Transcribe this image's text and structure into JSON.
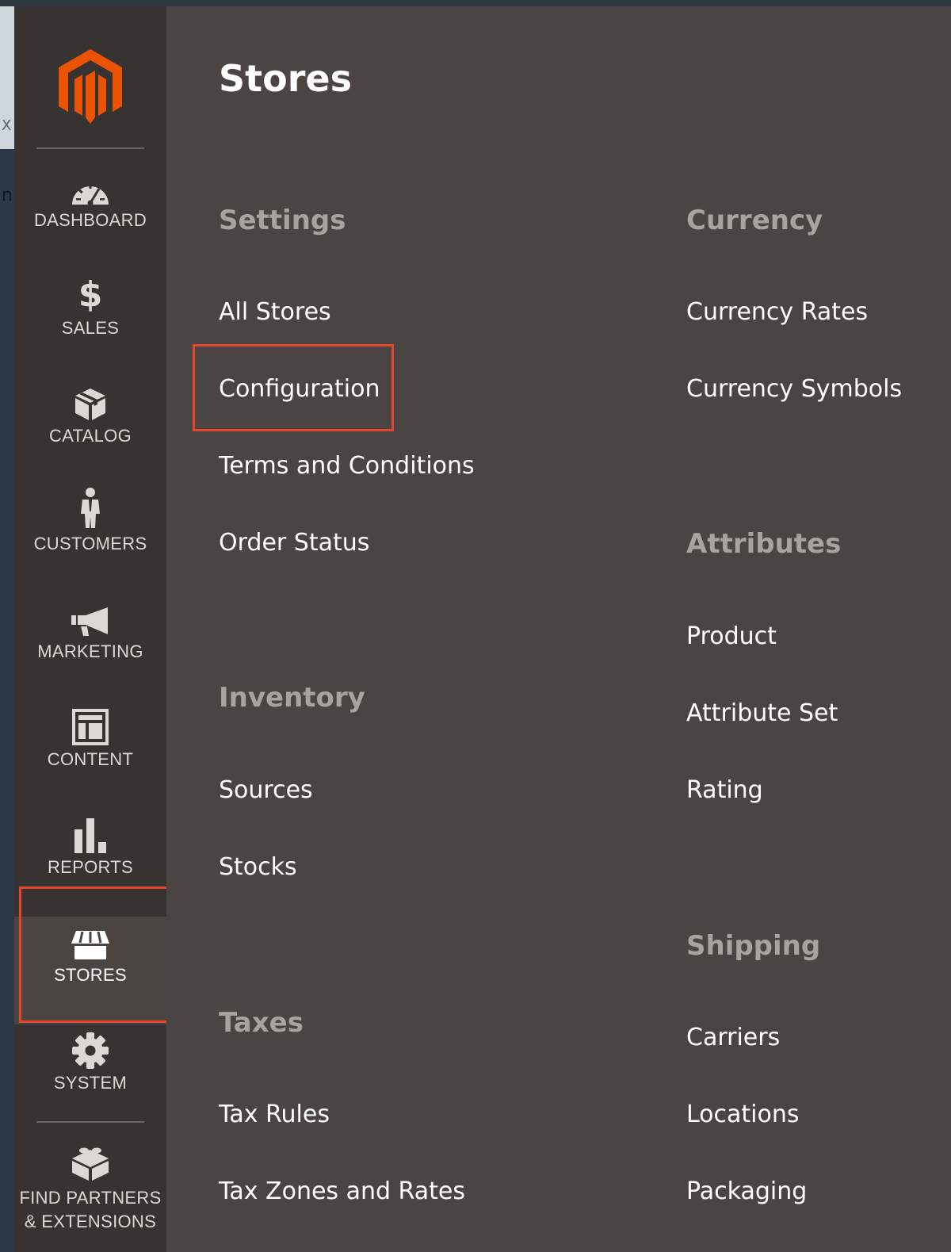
{
  "edge": {
    "fragments": [
      "n",
      "X"
    ]
  },
  "sidebar": {
    "items": [
      {
        "label": "DASHBOARD",
        "icon": "dashboard-gauge-icon"
      },
      {
        "label": "SALES",
        "icon": "dollar-icon"
      },
      {
        "label": "CATALOG",
        "icon": "box-icon"
      },
      {
        "label": "CUSTOMERS",
        "icon": "person-icon"
      },
      {
        "label": "MARKETING",
        "icon": "megaphone-icon"
      },
      {
        "label": "CONTENT",
        "icon": "layout-icon"
      },
      {
        "label": "REPORTS",
        "icon": "bar-chart-icon"
      },
      {
        "label": "STORES",
        "icon": "storefront-icon",
        "active": true
      },
      {
        "label": "SYSTEM",
        "icon": "gear-icon"
      }
    ],
    "extensions": {
      "line1": "FIND PARTNERS",
      "line2": "& EXTENSIONS",
      "icon": "bricks-icon"
    }
  },
  "panel": {
    "title": "Stores",
    "settings": {
      "title": "Settings",
      "links": [
        "All Stores",
        "Configuration",
        "Terms and Conditions",
        "Order Status"
      ]
    },
    "inventory": {
      "title": "Inventory",
      "links": [
        "Sources",
        "Stocks"
      ]
    },
    "taxes": {
      "title": "Taxes",
      "links": [
        "Tax Rules",
        "Tax Zones and Rates"
      ]
    },
    "currency": {
      "title": "Currency",
      "links": [
        "Currency Rates",
        "Currency Symbols"
      ]
    },
    "attributes": {
      "title": "Attributes",
      "links": [
        "Product",
        "Attribute Set",
        "Rating"
      ]
    },
    "shipping": {
      "title": "Shipping",
      "links": [
        "Carriers",
        "Locations",
        "Packaging"
      ]
    }
  },
  "colors": {
    "accent": "#eb5202",
    "highlight": "#e6452d",
    "sidebar_bg": "#373330",
    "panel_bg": "#4a4542"
  }
}
